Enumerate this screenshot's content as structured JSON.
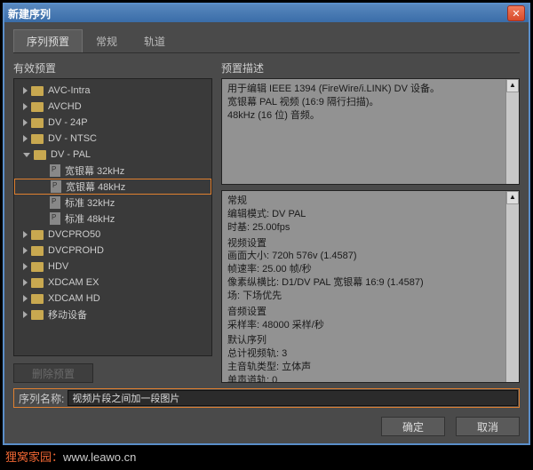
{
  "window": {
    "title": "新建序列"
  },
  "tabs": {
    "t0": "序列预置",
    "t1": "常规",
    "t2": "轨道"
  },
  "left": {
    "header": "有效预置"
  },
  "tree": {
    "folders_top": [
      "AVC-Intra",
      "AVCHD",
      "DV - 24P",
      "DV - NTSC"
    ],
    "expanded": "DV - PAL",
    "presets": [
      "宽银幕 32kHz",
      "宽银幕 48kHz",
      "标准 32kHz",
      "标准 48kHz"
    ],
    "folders_bottom": [
      "DVCPRO50",
      "DVCPROHD",
      "HDV",
      "XDCAM EX",
      "XDCAM HD",
      "移动设备"
    ]
  },
  "right": {
    "header": "预置描述",
    "desc1": "用于编辑 IEEE 1394 (FireWire/i.LINK) DV 设备。",
    "desc2": "宽银幕 PAL 视频 (16:9 隔行扫描)。",
    "desc3": "48kHz (16 位) 音频。",
    "g_general": "常规",
    "g_mode": "编辑模式: DV PAL",
    "g_tb": "时基: 25.00fps",
    "g_video": "视频设置",
    "g_size": "画面大小: 720h 576v (1.4587)",
    "g_fps": "帧速率: 25.00 帧/秒",
    "g_par": "像素纵横比: D1/DV PAL 宽银幕 16:9 (1.4587)",
    "g_field": "场: 下场优先",
    "g_audio": "音频设置",
    "g_sr": "采样率: 48000 采样/秒",
    "g_seq": "默认序列",
    "g_vt": "总计视频轨: 3",
    "g_at": "主音轨类型: 立体声",
    "g_mt": "单声道轨: 0"
  },
  "buttons": {
    "delete": "删除预置",
    "ok": "确定",
    "cancel": "取消"
  },
  "sequence": {
    "label": "序列名称:",
    "value": "视频片段之间加一段图片"
  },
  "footer": {
    "a": "狸窝家园：",
    "b": "www.leawo.cn"
  }
}
